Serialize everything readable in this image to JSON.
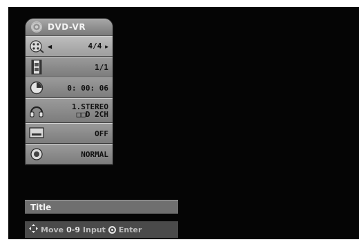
{
  "osd": {
    "header": {
      "title": "DVD-VR",
      "icon": "disc-icon"
    },
    "rows": [
      {
        "icon": "program-icon",
        "value": "4/4",
        "selected": true
      },
      {
        "icon": "chapter-film-icon",
        "value": "1/1"
      },
      {
        "icon": "clock-icon",
        "value": "0: 00: 06"
      },
      {
        "icon": "headphones-icon",
        "value_line1": "1.STEREO",
        "value_line2": "□□D 2CH"
      },
      {
        "icon": "subtitle-icon",
        "value": "OFF"
      },
      {
        "icon": "speaker-icon",
        "value": "NORMAL"
      }
    ]
  },
  "title_bar": {
    "label": "Title"
  },
  "help_bar": {
    "move_label": "Move",
    "input_key": "0-9",
    "input_label": "Input",
    "enter_label": "Enter"
  }
}
